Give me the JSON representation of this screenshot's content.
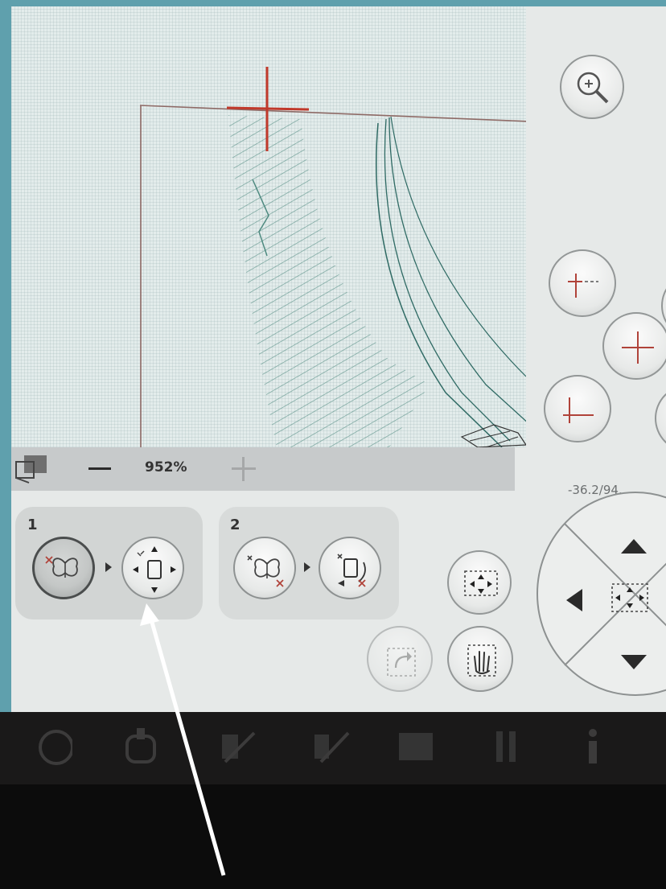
{
  "zoom": {
    "level_label": "952%"
  },
  "position_readout": "-36.2/94.",
  "steps": [
    {
      "number": "1",
      "selected_step": "move-design"
    },
    {
      "number": "2"
    }
  ],
  "icons": {
    "zoom_magnifier": "magnifier-icon",
    "align_top_left": "align-top-left-icon",
    "align_center": "align-center-icon",
    "align_bottom_left": "align-bottom-left-icon",
    "move_to_center": "move-center-icon",
    "rotate": "rotate-icon",
    "pan": "hand-icon",
    "dpad": "directional-pad-icon",
    "layers": "layers-icon"
  },
  "colors": {
    "screen_bg": "#e6e9e8",
    "crosshair": "#c0392b",
    "stitch": "#3b7a6f",
    "annotation_arrow": "#ffffff"
  }
}
